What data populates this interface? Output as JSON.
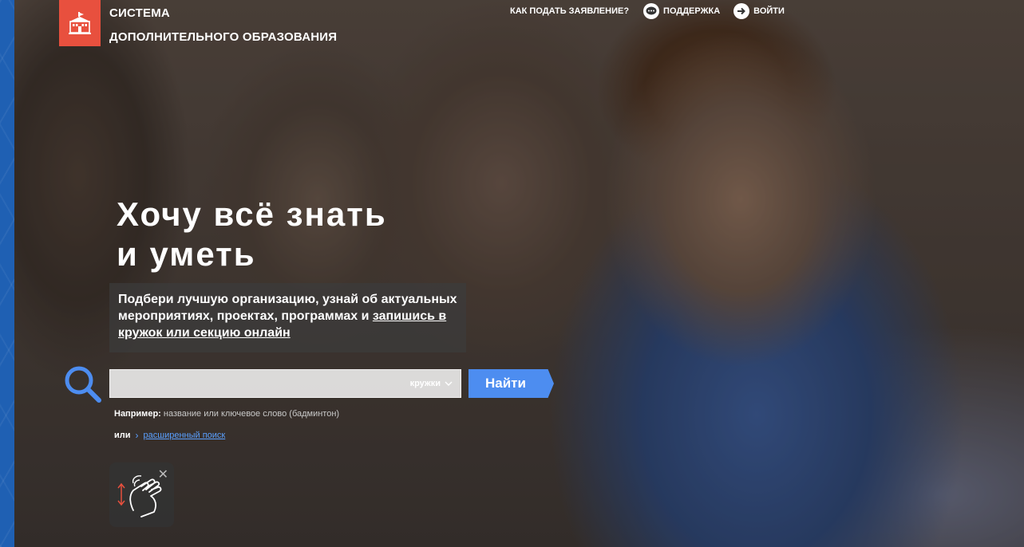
{
  "header": {
    "logo_line1": "СИСТЕМА",
    "logo_line2": "ДОПОЛНИТЕЛЬНОГО ОБРАЗОВАНИЯ",
    "nav": {
      "apply": "КАК ПОДАТЬ ЗАЯВЛЕНИЕ?",
      "support": "ПОДДЕРЖКА",
      "login": "ВОЙТИ"
    }
  },
  "hero": {
    "headline_line1": "Хочу всё знать",
    "headline_line2": "и уметь",
    "desc_text": "Подбери лучшую организацию, узнай об актуальных мероприятиях, проектах, программах и",
    "desc_link": "запишись в кружок или секцию онлайн"
  },
  "search": {
    "input_value": "",
    "input_placeholder": "",
    "type_selected": "кружки",
    "button_label": "Найти",
    "example_label": "Например:",
    "example_text": "название или ключевое слово (бадминтон)",
    "or_label": "или",
    "advanced_link": "расширенный поиск"
  },
  "colors": {
    "brand_red": "#e8503e",
    "accent_blue": "#4d8df0",
    "frame_blue": "#1f60b3"
  },
  "icons": {
    "logo": "school-building-icon",
    "support": "chat-bubble-icon",
    "login": "arrow-right-circle-icon",
    "search": "magnifier-icon",
    "dropdown": "chevron-down-icon",
    "gesture": "hand-swipe-icon",
    "close": "close-icon"
  }
}
